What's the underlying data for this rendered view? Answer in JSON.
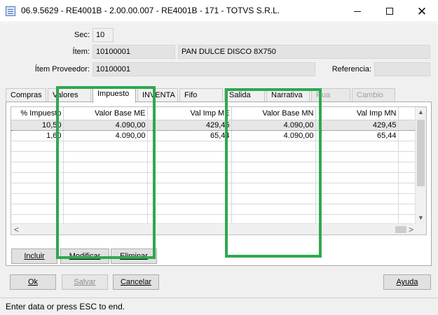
{
  "window": {
    "title": "06.9.5629 - RE4001B - 2.00.00.007 - RE4001B - 171 - TOTVS S.R.L.",
    "minimize_glyph": "",
    "maximize_glyph": "",
    "close_glyph": "✕"
  },
  "form": {
    "sec_label": "Sec:",
    "sec_value": "10",
    "item_label": "Ítem:",
    "item_code": "10100001",
    "item_desc": "PAN DULCE DISCO 8X750",
    "item_prov_label": "Ítem Proveedor:",
    "item_prov_value": "10100001",
    "referencia_label": "Referencia:",
    "referencia_value": ""
  },
  "tabs": [
    {
      "label": "Compras",
      "state": "normal"
    },
    {
      "label": "Valores",
      "state": "normal"
    },
    {
      "label": "Impuesto",
      "state": "active"
    },
    {
      "label": "INVENTA",
      "state": "normal"
    },
    {
      "label": "Fifo",
      "state": "normal"
    },
    {
      "label": "Salida",
      "state": "normal"
    },
    {
      "label": "Narrativa",
      "state": "normal"
    },
    {
      "label": "Rua",
      "state": "disabled"
    },
    {
      "label": "Cambio",
      "state": "disabled"
    }
  ],
  "grid": {
    "columns": [
      "% Impuesto",
      "Valor Base ME",
      "Val Imp ME",
      "Valor Base MN",
      "Val Imp MN"
    ],
    "rows": [
      [
        "10,50",
        "4.090,00",
        "429,45",
        "4.090,00",
        "429,45"
      ],
      [
        "1,60",
        "4.090,00",
        "65,44",
        "4.090,00",
        "65,44"
      ]
    ],
    "empty_rows": 9,
    "selected_row": 0,
    "scroll_up": "▲",
    "scroll_down": "▼",
    "scroll_left": "<",
    "scroll_right": ">"
  },
  "grid_buttons": {
    "incluir": "Incluir",
    "modificar": "Modificar",
    "eliminar": "Eliminar"
  },
  "footer_buttons": {
    "ok": "Ok",
    "salvar": "Salvar",
    "cancelar": "Cancelar",
    "ayuda": "Ayuda"
  },
  "status": {
    "message": "Enter data or press ESC to end."
  },
  "colors": {
    "highlight": "#2fa84f",
    "window_bg": "#f0f0f0",
    "readonly_field": "#e3e3e3"
  }
}
